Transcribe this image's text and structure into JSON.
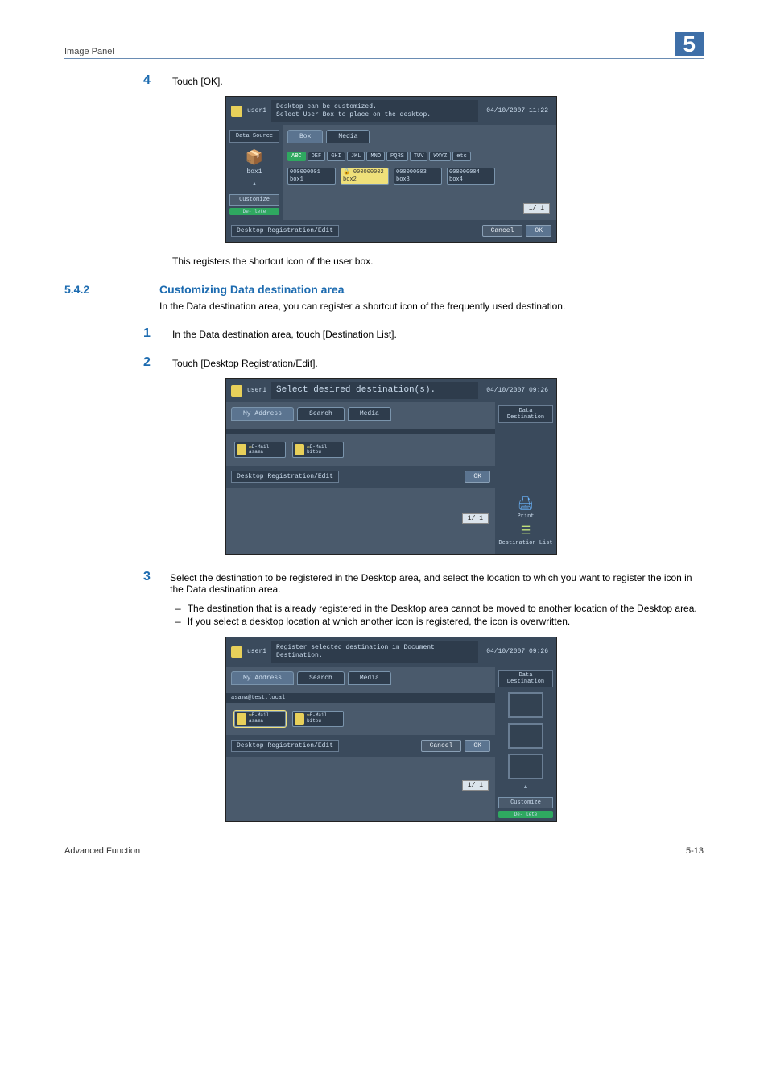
{
  "page_header": {
    "left": "Image Panel",
    "chapter": "5"
  },
  "step4": {
    "num": "4",
    "text": "Touch [OK]."
  },
  "screenshot1": {
    "user": "user1",
    "msg_l1": "Desktop can be customized.",
    "msg_l2": "Select User Box to place on the desktop.",
    "date": "04/10/2007 11:22",
    "side_label": "Data Source",
    "slot1": "box1",
    "customize": "Customize",
    "delete": "De-\nlete",
    "tab_box": "Box",
    "tab_media": "Media",
    "alpha": [
      "ABC",
      "DEF",
      "GHI",
      "JKL",
      "MNO",
      "PQRS",
      "TUV",
      "WXYZ",
      "etc"
    ],
    "boxes": [
      {
        "id": "000000001",
        "name": "box1"
      },
      {
        "id": "000000002",
        "name": "box2"
      },
      {
        "id": "000000003",
        "name": "box3"
      },
      {
        "id": "000000004",
        "name": "box4"
      }
    ],
    "page": "1/  1",
    "foot_label": "Desktop Registration/Edit",
    "cancel": "Cancel",
    "ok": "OK"
  },
  "after_screenshot1": "This registers the shortcut icon of the user box.",
  "section": {
    "num": "5.4.2",
    "title": "Customizing Data destination area"
  },
  "section_intro": "In the Data destination area, you can register a shortcut icon of the frequently used destination.",
  "step1": {
    "num": "1",
    "text": "In the Data destination area, touch [Destination List]."
  },
  "step2": {
    "num": "2",
    "text": "Touch [Desktop Registration/Edit]."
  },
  "screenshot2": {
    "user": "user1",
    "msg": "Select desired destination(s).",
    "date": "04/10/2007 09:26",
    "tab_myaddr": "My Address",
    "tab_search": "Search",
    "tab_media": "Media",
    "dests": [
      {
        "type": "E-Mail",
        "name": "asama"
      },
      {
        "type": "E-Mail",
        "name": "bitou"
      }
    ],
    "page": "1/  1",
    "foot_label": "Desktop Registration/Edit",
    "ok": "OK",
    "side_title": "Data Destination",
    "side_print": "Print",
    "side_destlist": "Destination List"
  },
  "step3": {
    "num": "3",
    "text": "Select the destination to be registered in the Desktop area, and select the location to which you want to register the icon in the Data destination area.",
    "b1": "The destination that is already registered in the Desktop area cannot be moved to another location of the Desktop area.",
    "b2": "If you select a desktop location at which another icon is registered, the icon is overwritten."
  },
  "screenshot3": {
    "user": "user1",
    "msg": "Register selected destination in Document Destination.",
    "date": "04/10/2007 09:26",
    "tab_myaddr": "My Address",
    "tab_search": "Search",
    "tab_media": "Media",
    "addr_line": "asama@test.local",
    "dests": [
      {
        "type": "E-Mail",
        "name": "asama"
      },
      {
        "type": "E-Mail",
        "name": "bitou"
      }
    ],
    "page": "1/  1",
    "foot_label": "Desktop Registration/Edit",
    "cancel": "Cancel",
    "ok": "OK",
    "side_title": "Data Destination",
    "customize": "Customize",
    "delete": "De-\nlete"
  },
  "footer": {
    "left": "Advanced Function",
    "right": "5-13"
  }
}
